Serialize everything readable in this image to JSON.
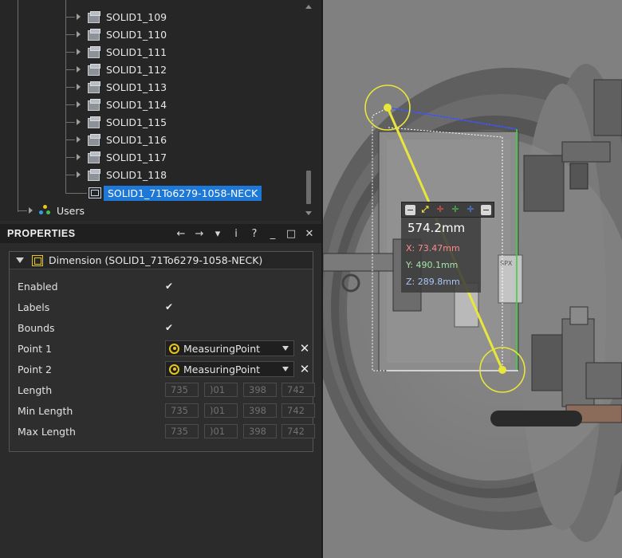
{
  "tree": {
    "items": [
      {
        "label": "SOLID1_109"
      },
      {
        "label": "SOLID1_110"
      },
      {
        "label": "SOLID1_111"
      },
      {
        "label": "SOLID1_112"
      },
      {
        "label": "SOLID1_113"
      },
      {
        "label": "SOLID1_114"
      },
      {
        "label": "SOLID1_115"
      },
      {
        "label": "SOLID1_116"
      },
      {
        "label": "SOLID1_117"
      },
      {
        "label": "SOLID1_118"
      }
    ],
    "selected_label": "SOLID1_71To6279-1058-NECK",
    "users_label": "Users"
  },
  "properties": {
    "title": "PROPERTIES",
    "tools": {
      "back": "←",
      "forward": "→",
      "menu": "▾",
      "info": "i",
      "help": "?",
      "minimize": "_",
      "maximize": "□",
      "close": "✕"
    },
    "group_title": "Dimension (SOLID1_71To6279-1058-NECK)",
    "rows": {
      "enabled": {
        "label": "Enabled",
        "checked": "✔"
      },
      "labels": {
        "label": "Labels",
        "checked": "✔"
      },
      "bounds": {
        "label": "Bounds",
        "checked": "✔"
      },
      "point1": {
        "label": "Point 1",
        "value": "MeasuringPoint"
      },
      "point2": {
        "label": "Point 2",
        "value": "MeasuringPoint"
      },
      "length": {
        "label": "Length",
        "fields": [
          "735",
          ")01",
          "398",
          "742"
        ]
      },
      "min_length": {
        "label": "Min Length",
        "fields": [
          "735",
          ")01",
          "398",
          "742"
        ]
      },
      "max_length": {
        "label": "Max Length",
        "fields": [
          "735",
          ")01",
          "398",
          "742"
        ]
      }
    },
    "clear_glyph": "✕"
  },
  "measurement": {
    "length": "574.2mm",
    "x": "X: 73.47mm",
    "y": "Y: 490.1mm",
    "z": "Z: 289.8mm",
    "colors": {
      "x": "#ff8a8a",
      "y": "#a6e3a6",
      "z": "#a9c7f5",
      "line": "#e8e63a"
    }
  },
  "viewport": {
    "label_spx": "SPX"
  }
}
